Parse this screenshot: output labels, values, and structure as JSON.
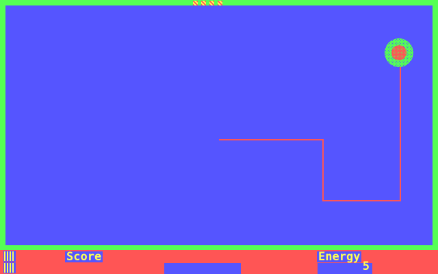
{
  "game": {
    "hud": {
      "score_label": "Score",
      "energy_label": "Energy",
      "energy_value": "5",
      "lives_shown": 2
    },
    "top_markers_count": 4,
    "colors": {
      "border": "#55ff55",
      "playfield": "#5555ff",
      "hud_background": "#ff5555",
      "trail": "#ff5555",
      "text": "#ffff55",
      "player_outer": "#55ff55",
      "player_inner": "#ff5555"
    }
  }
}
